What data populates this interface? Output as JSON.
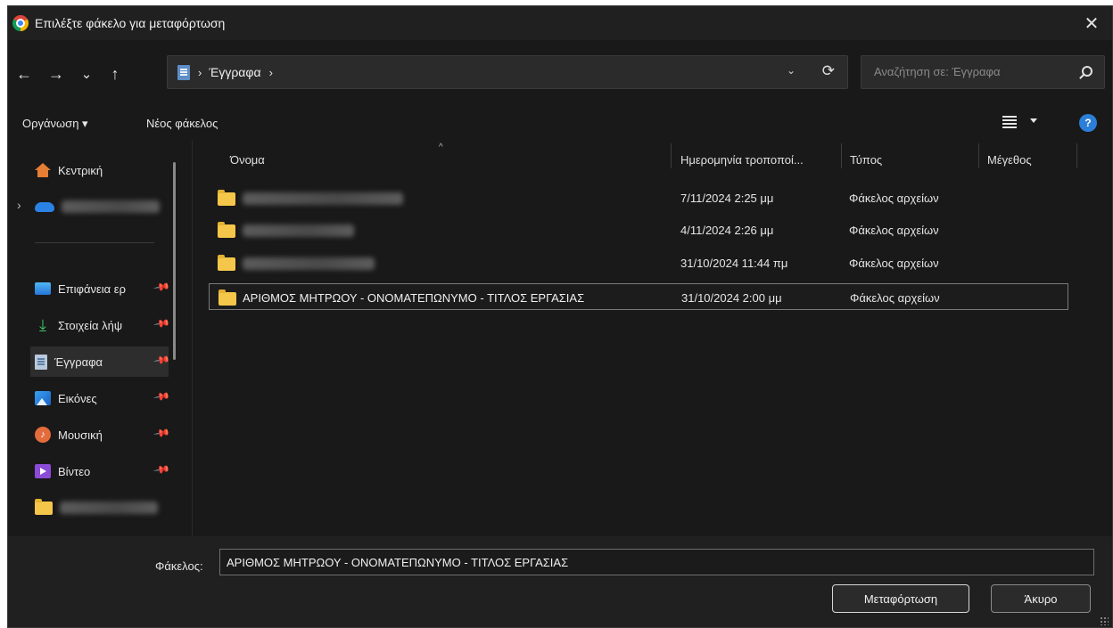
{
  "window": {
    "title": "Επιλέξτε φάκελο για μεταφόρτωση"
  },
  "nav": {
    "back": "←",
    "forward": "→",
    "recent": "⌄",
    "up": "↑",
    "breadcrumb": [
      "Έγγραφα"
    ],
    "refresh": "⟳",
    "search_placeholder": "Αναζήτηση σε: Έγγραφα"
  },
  "toolbar": {
    "organize": "Οργάνωση ▾",
    "new_folder": "Νέος φάκελος",
    "help": "?"
  },
  "sidebar": {
    "items": [
      {
        "label": "Κεντρική",
        "icon": "home-icon"
      },
      {
        "label": "Επιφάνεια ερ",
        "icon": "desktop-icon",
        "pinned": true
      },
      {
        "label": "Στοιχεία λήψ",
        "icon": "download-icon",
        "pinned": true
      },
      {
        "label": "Έγγραφα",
        "icon": "documents-icon",
        "pinned": true,
        "selected": true
      },
      {
        "label": "Εικόνες",
        "icon": "pictures-icon",
        "pinned": true
      },
      {
        "label": "Μουσική",
        "icon": "music-icon",
        "pinned": true
      },
      {
        "label": "Βίντεο",
        "icon": "video-icon",
        "pinned": true
      }
    ],
    "pin_glyph": "📌",
    "music_glyph": "♪",
    "download_glyph": "⤓",
    "expander": "›"
  },
  "columns": {
    "name": "Όνομα",
    "modified": "Ημερομηνία τροποποί...",
    "type": "Τύπος",
    "size": "Μέγεθος",
    "sort_glyph": "^"
  },
  "files": [
    {
      "name": "",
      "modified": "7/11/2024 2:25 μμ",
      "type": "Φάκελος αρχείων"
    },
    {
      "name": "",
      "modified": "4/11/2024 2:26 μμ",
      "type": "Φάκελος αρχείων"
    },
    {
      "name": "",
      "modified": "31/10/2024 11:44 πμ",
      "type": "Φάκελος αρχείων"
    },
    {
      "name": "ΑΡΙΘΜΟΣ ΜΗΤΡΩΟΥ - ΟΝΟΜΑΤΕΠΩΝΥΜΟ - ΤΙΤΛΟΣ ΕΡΓΑΣΙΑΣ",
      "modified": "31/10/2024 2:00 μμ",
      "type": "Φάκελος αρχείων",
      "selected": true
    }
  ],
  "footer": {
    "folder_label": "Φάκελος:",
    "folder_value": "ΑΡΙΘΜΟΣ ΜΗΤΡΩΟΥ - ΟΝΟΜΑΤΕΠΩΝΥΜΟ - ΤΙΤΛΟΣ ΕΡΓΑΣΙΑΣ",
    "upload": "Μεταφόρτωση",
    "cancel": "Άκυρο"
  },
  "colors": {
    "background": "#191919",
    "titlebar": "#202020",
    "accent": "#2b7fd9",
    "folder": "#f4c64a"
  }
}
